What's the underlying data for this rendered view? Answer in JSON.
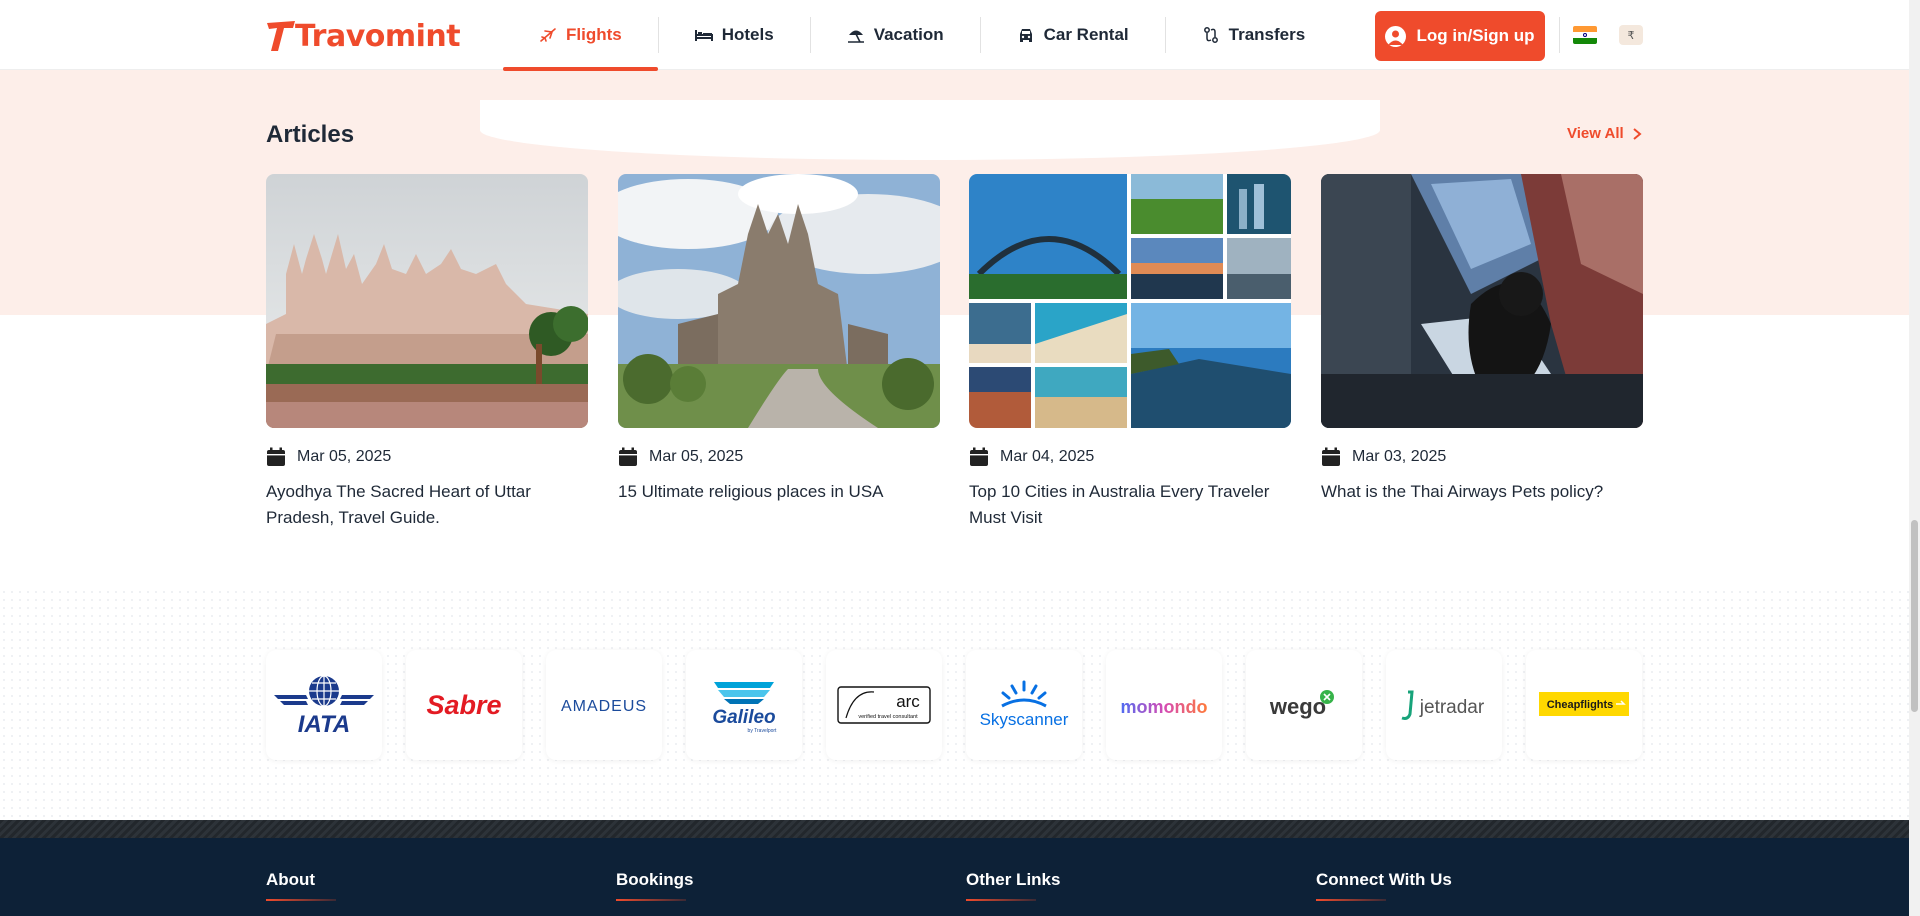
{
  "header": {
    "logo": "Travomint",
    "nav": [
      {
        "label": "Flights",
        "icon": "flight-icon",
        "active": true
      },
      {
        "label": "Hotels",
        "icon": "bed-icon",
        "active": false
      },
      {
        "label": "Vacation",
        "icon": "beach-umbrella-icon",
        "active": false
      },
      {
        "label": "Car Rental",
        "icon": "car-icon",
        "active": false
      },
      {
        "label": "Transfers",
        "icon": "transfer-icon",
        "active": false
      }
    ],
    "login_label": "Log in/Sign up",
    "country_flag": "india-flag-icon",
    "currency_symbol": "₹"
  },
  "articles": {
    "title": "Articles",
    "view_all": "View All",
    "items": [
      {
        "date": "Mar 05, 2025",
        "title": "Ayodhya The Sacred Heart of Uttar Pradesh, Travel Guide.",
        "image": "temple-photo"
      },
      {
        "date": "Mar 05, 2025",
        "title": "15 Ultimate religious places in USA",
        "image": "cathedral-photo"
      },
      {
        "date": "Mar 04, 2025",
        "title": "Top 10 Cities in Australia Every Traveler Must Visit",
        "image": "australia-collage-photo"
      },
      {
        "date": "Mar 03, 2025",
        "title": "What is the Thai Airways Pets policy?",
        "image": "pet-cat-photo"
      }
    ]
  },
  "partners": [
    {
      "name": "IATA",
      "label": "IATA"
    },
    {
      "name": "Sabre",
      "label": "Sabre"
    },
    {
      "name": "Amadeus",
      "label": "AMADEUS"
    },
    {
      "name": "Galileo",
      "label": "Galileo",
      "sub": "by Travelport"
    },
    {
      "name": "ARC",
      "label": "arc",
      "sub": "verified travel consultant"
    },
    {
      "name": "Skyscanner",
      "label": "Skyscanner"
    },
    {
      "name": "momondo",
      "label": "momondo"
    },
    {
      "name": "wego",
      "label": "wego"
    },
    {
      "name": "jetradar",
      "label": "jetradar"
    },
    {
      "name": "Cheapflights",
      "label": "Cheapflights"
    }
  ],
  "footer": {
    "columns": [
      "About",
      "Bookings",
      "Other Links",
      "Connect With Us"
    ]
  },
  "colors": {
    "brand": "#ef4b2c",
    "band_bg": "#fdeee9",
    "footer_bg": "#0d2137"
  }
}
